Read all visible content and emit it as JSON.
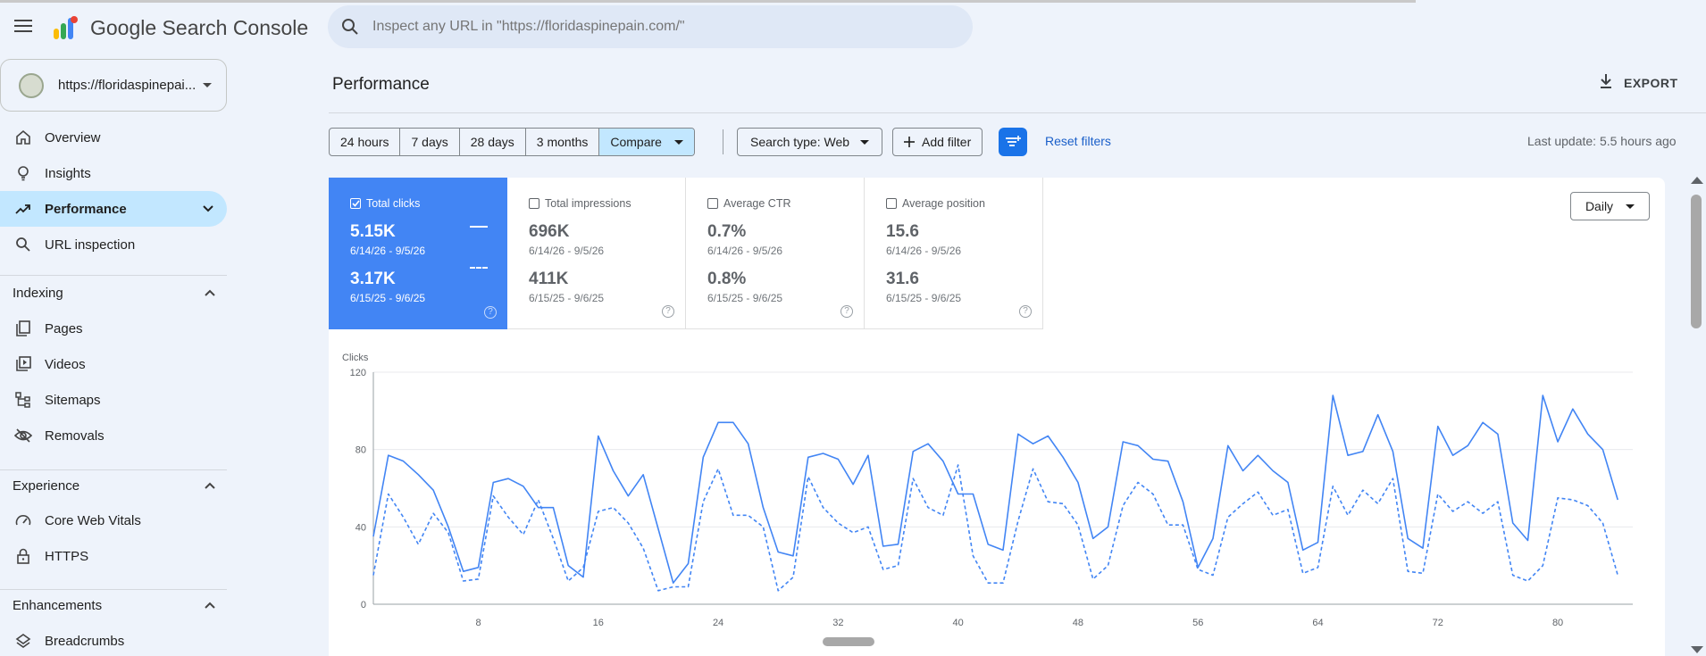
{
  "app": {
    "title": "Google Search Console"
  },
  "search": {
    "placeholder": "Inspect any URL in \"https://floridaspinepain.com/\""
  },
  "property": {
    "label": "https://floridaspinepai..."
  },
  "sidebar": {
    "items": [
      {
        "label": "Overview",
        "icon": "home-icon"
      },
      {
        "label": "Insights",
        "icon": "lightbulb-icon"
      },
      {
        "label": "Performance",
        "icon": "trending-up-icon"
      },
      {
        "label": "URL inspection",
        "icon": "search-icon"
      }
    ],
    "indexing": {
      "label": "Indexing",
      "items": [
        {
          "label": "Pages"
        },
        {
          "label": "Videos"
        },
        {
          "label": "Sitemaps"
        },
        {
          "label": "Removals"
        }
      ]
    },
    "experience": {
      "label": "Experience",
      "items": [
        {
          "label": "Core Web Vitals"
        },
        {
          "label": "HTTPS"
        }
      ]
    },
    "enhancements": {
      "label": "Enhancements",
      "items": [
        {
          "label": "Breadcrumbs"
        }
      ]
    }
  },
  "page": {
    "title": "Performance",
    "export_label": "EXPORT"
  },
  "toolbar": {
    "ranges": [
      "24 hours",
      "7 days",
      "28 days",
      "3 months"
    ],
    "compare": "Compare",
    "search_type": "Search type: Web",
    "add_filter": "Add filter",
    "reset_filters": "Reset filters",
    "last_update": "Last update: 5.5 hours ago"
  },
  "metrics": [
    {
      "label": "Total clicks",
      "checked": true,
      "value1": "5.15K",
      "range1": "6/14/26 - 9/5/26",
      "value2": "3.17K",
      "range2": "6/15/25 - 9/6/25"
    },
    {
      "label": "Total impressions",
      "checked": false,
      "value1": "696K",
      "range1": "6/14/26 - 9/5/26",
      "value2": "411K",
      "range2": "6/15/25 - 9/6/25"
    },
    {
      "label": "Average CTR",
      "checked": false,
      "value1": "0.7%",
      "range1": "6/14/26 - 9/5/26",
      "value2": "0.8%",
      "range2": "6/15/25 - 9/6/25"
    },
    {
      "label": "Average position",
      "checked": false,
      "value1": "15.6",
      "range1": "6/14/26 - 9/5/26",
      "value2": "31.6",
      "range2": "6/15/25 - 9/6/25"
    }
  ],
  "granularity": "Daily",
  "chart_data": {
    "type": "line",
    "ylabel": "Clicks",
    "ylim": [
      0,
      120
    ],
    "yticks": [
      0,
      40,
      80,
      120
    ],
    "xticks": [
      8,
      16,
      24,
      32,
      40,
      48,
      56,
      64,
      72,
      80
    ],
    "xlim": [
      1,
      85
    ],
    "grid": true,
    "series": [
      {
        "style": "solid",
        "color": "#4285f4",
        "values": [
          35,
          77,
          74,
          67,
          59,
          40,
          17,
          19,
          63,
          65,
          61,
          50,
          50,
          20,
          14,
          87,
          69,
          56,
          67,
          39,
          11,
          21,
          76,
          94,
          94,
          83,
          50,
          27,
          25,
          76,
          78,
          75,
          62,
          77,
          30,
          31,
          79,
          83,
          74,
          57,
          57,
          31,
          28,
          88,
          83,
          87,
          76,
          63,
          34,
          40,
          84,
          82,
          75,
          74,
          53,
          19,
          34,
          82,
          69,
          77,
          69,
          63,
          28,
          32,
          108,
          77,
          79,
          98,
          79,
          34,
          29,
          92,
          77,
          82,
          94,
          88,
          42,
          33,
          108,
          84,
          101,
          88,
          80,
          54
        ]
      },
      {
        "style": "dashed",
        "color": "#4285f4",
        "values": [
          15,
          57,
          45,
          31,
          47,
          37,
          12,
          13,
          56,
          45,
          36,
          54,
          34,
          12,
          19,
          48,
          50,
          42,
          29,
          7,
          9,
          9,
          53,
          70,
          46,
          46,
          40,
          7,
          14,
          66,
          50,
          42,
          37,
          40,
          18,
          20,
          65,
          50,
          46,
          72,
          25,
          11,
          11,
          43,
          70,
          53,
          52,
          41,
          13,
          20,
          51,
          63,
          57,
          41,
          41,
          18,
          15,
          45,
          52,
          58,
          46,
          49,
          16,
          19,
          61,
          46,
          59,
          52,
          65,
          17,
          16,
          57,
          48,
          53,
          47,
          53,
          15,
          12,
          20,
          55,
          54,
          51,
          42,
          15
        ]
      }
    ]
  }
}
